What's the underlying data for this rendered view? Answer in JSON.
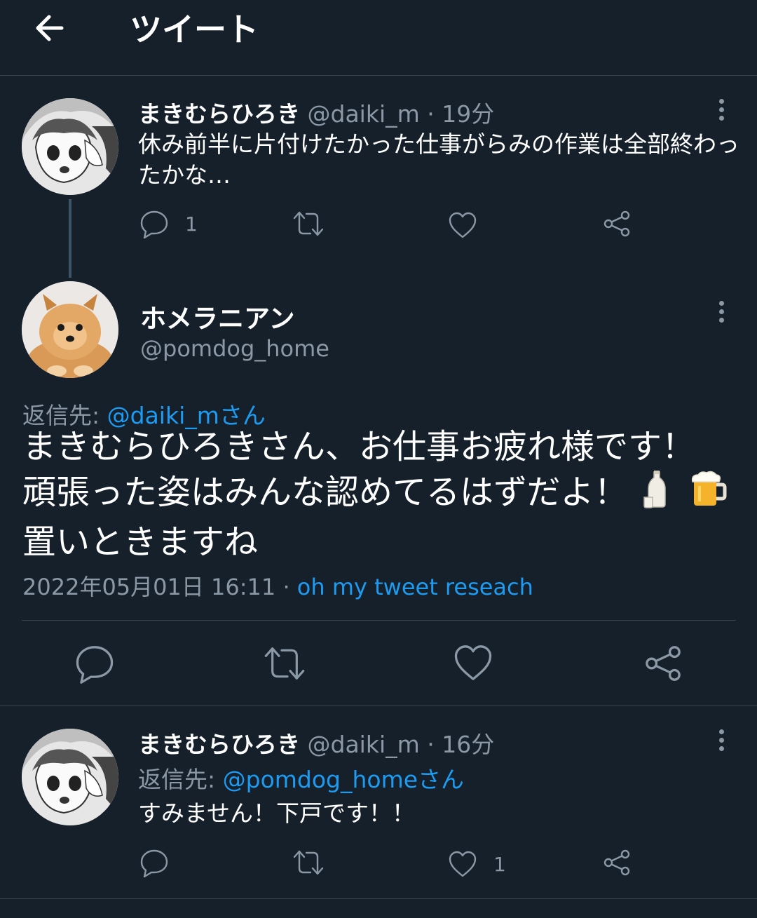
{
  "header": {
    "title": "ツイート"
  },
  "tweets": [
    {
      "name": "まきむらひろき",
      "handle": "@daiki_m",
      "sep": "·",
      "time": "19分",
      "text": "休み前半に片付けたかった仕事がらみの作業は全部終わったかな…",
      "reply_count": "1",
      "like_count": ""
    },
    {
      "name": "まきむらひろき",
      "handle": "@daiki_m",
      "sep": "·",
      "time": "16分",
      "reply_label": "返信先:",
      "reply_target": "@pomdog_homeさん",
      "text": "すみません！下戸です！！",
      "reply_count": "",
      "like_count": "1"
    }
  ],
  "focus": {
    "name": "ホメラニアン",
    "handle": "@pomdog_home",
    "reply_label": "返信先:",
    "reply_target": "@daiki_mさん",
    "line1": "まきむらひろきさん、お仕事お疲れ様です！",
    "line2": "頑張った姿はみんな認めてるはずだよ！",
    "line3": "置いときますね",
    "timestamp": "2022年05月01日 16:11",
    "sep": "·",
    "source": "oh my tweet reseach"
  },
  "colors": {
    "background": "#15202b",
    "text": "#ffffff",
    "muted": "#8b98a5",
    "link": "#1d9bf0",
    "divider": "#38444d"
  },
  "icons": [
    "back-arrow-icon",
    "more-icon",
    "reply-icon",
    "retweet-icon",
    "like-icon",
    "share-icon",
    "sake-emoji",
    "beer-emoji"
  ]
}
